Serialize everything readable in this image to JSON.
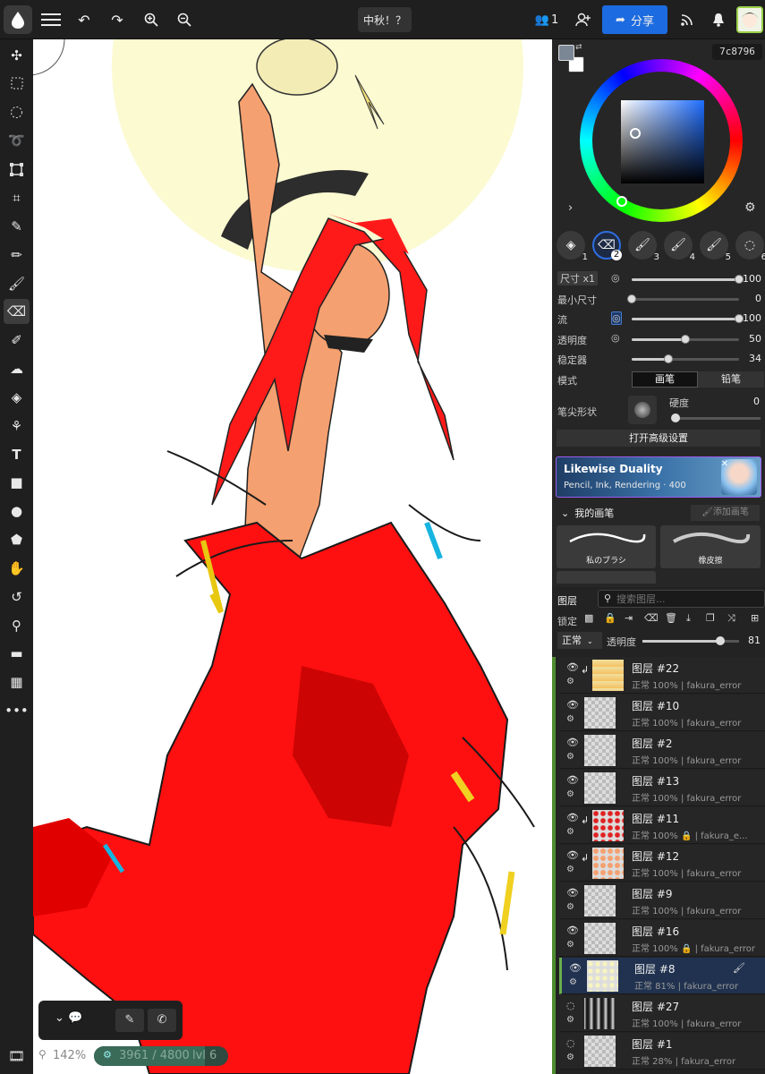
{
  "topbar": {
    "doc_title": "中秋！？",
    "user_count": "1",
    "share_label": "分享"
  },
  "color": {
    "hex": "7c8796",
    "primary": "#7c8796"
  },
  "brush_slots": [
    "1",
    "2",
    "3",
    "4",
    "5",
    "6"
  ],
  "brush_settings": {
    "size_label": "尺寸 x1",
    "size_value": "100",
    "size_level": 1.0,
    "min_size_label": "最小尺寸",
    "min_size_value": "0",
    "min_size_level": 0.0,
    "flow_label": "流",
    "flow_value": "100",
    "flow_level": 1.0,
    "opacity_label": "透明度",
    "opacity_value": "50",
    "opacity_level": 0.5,
    "stabilizer_label": "稳定器",
    "stabilizer_value": "34",
    "stabilizer_level": 0.34,
    "mode_label": "模式",
    "mode_brush": "画笔",
    "mode_pencil": "铅笔",
    "tip_label": "笔尖形状",
    "hardness_label": "硬度",
    "hardness_value": "0",
    "advanced_label": "打开高级设置"
  },
  "promo": {
    "title": "Likewise Duality",
    "subtitle": "Pencil, Ink, Rendering · 400"
  },
  "my_brushes": {
    "header": "我的画笔",
    "add_label": "添加画笔",
    "items": [
      "私のブラシ",
      "橡皮擦"
    ]
  },
  "layers_panel": {
    "title": "图层",
    "search_placeholder": "搜索图层...",
    "lock_label": "锁定",
    "blend_mode": "正常",
    "opacity_label": "透明度",
    "opacity_value": "81",
    "opacity_level": 0.81,
    "layers": [
      {
        "name": "图层 #22",
        "meta": "正常 100% | fakura_error"
      },
      {
        "name": "图层 #10",
        "meta": "正常 100% | fakura_error"
      },
      {
        "name": "图层 #2",
        "meta": "正常 100% | fakura_error"
      },
      {
        "name": "图层 #13",
        "meta": "正常 100% | fakura_error"
      },
      {
        "name": "图层 #11",
        "meta": "正常 100% 🔒 | fakura_e..."
      },
      {
        "name": "图层 #12",
        "meta": "正常 100% | fakura_error"
      },
      {
        "name": "图层 #9",
        "meta": "正常 100% | fakura_error"
      },
      {
        "name": "图层 #16",
        "meta": "正常 100% 🔒 | fakura_error"
      },
      {
        "name": "图层 #8",
        "meta": "正常 81% | fakura_error"
      },
      {
        "name": "图层 #27",
        "meta": "正常 100% | fakura_error"
      },
      {
        "name": "图层 #1",
        "meta": "正常 28% | fakura_error"
      }
    ]
  },
  "status": {
    "zoom": "142%",
    "progress": "3961 / 4800",
    "level": "lvl 6"
  }
}
